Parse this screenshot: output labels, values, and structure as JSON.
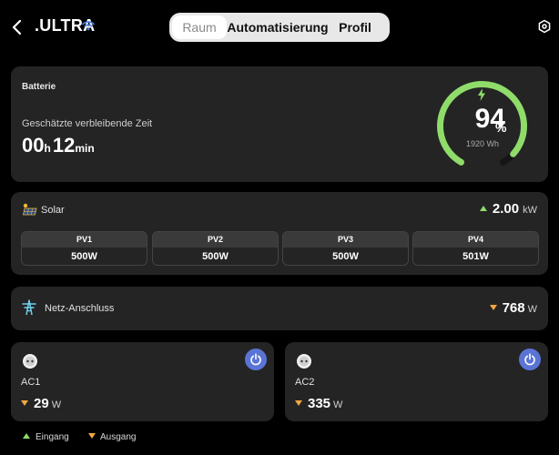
{
  "header": {
    "device_name": ".ULTRA",
    "tabs": [
      {
        "label": "Raum",
        "active": true
      },
      {
        "label": "Automatisierung",
        "active": false
      },
      {
        "label": "Profil",
        "active": false
      }
    ]
  },
  "battery": {
    "title": "Batterie",
    "runtime_label": "Geschätzte verbleibende Zeit",
    "runtime_hours": "00",
    "runtime_hours_unit": "h",
    "runtime_minutes": "12",
    "runtime_minutes_unit": "min",
    "percent": "94",
    "percent_sign": "%",
    "charge_fraction": 0.94,
    "capacity": "1920 Wh"
  },
  "solar": {
    "label": "Solar",
    "total_value": "2.00",
    "total_unit": "kW",
    "panels": [
      {
        "name": "PV1",
        "value": "500W"
      },
      {
        "name": "PV2",
        "value": "500W"
      },
      {
        "name": "PV3",
        "value": "500W"
      },
      {
        "name": "PV4",
        "value": "501W"
      }
    ]
  },
  "grid": {
    "label": "Netz-Anschluss",
    "value": "768",
    "unit": "W"
  },
  "outputs": [
    {
      "label": "AC1",
      "value": "29",
      "unit": "W"
    },
    {
      "label": "AC2",
      "value": "335",
      "unit": "W"
    }
  ],
  "legend": {
    "input": "Eingang",
    "output": "Ausgang"
  },
  "colors": {
    "accent_green": "#8fdc6a",
    "output_orange": "#f3a742",
    "power_button_blue": "#5a74d6",
    "card_bg": "#242424"
  }
}
